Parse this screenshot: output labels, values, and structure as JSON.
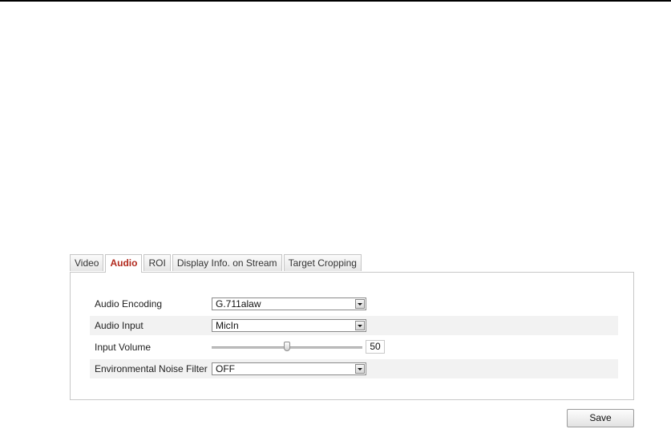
{
  "tabs": [
    "Video",
    "Audio",
    "ROI",
    "Display Info. on Stream",
    "Target Cropping"
  ],
  "active_tab": "Audio",
  "form": {
    "audio_encoding": {
      "label": "Audio Encoding",
      "value": "G.711alaw"
    },
    "audio_input": {
      "label": "Audio Input",
      "value": "MicIn"
    },
    "input_volume": {
      "label": "Input Volume",
      "value": "50",
      "fraction": 0.5
    },
    "noise_filter": {
      "label": "Environmental Noise Filter",
      "value": "OFF"
    }
  },
  "buttons": {
    "save": "Save"
  }
}
